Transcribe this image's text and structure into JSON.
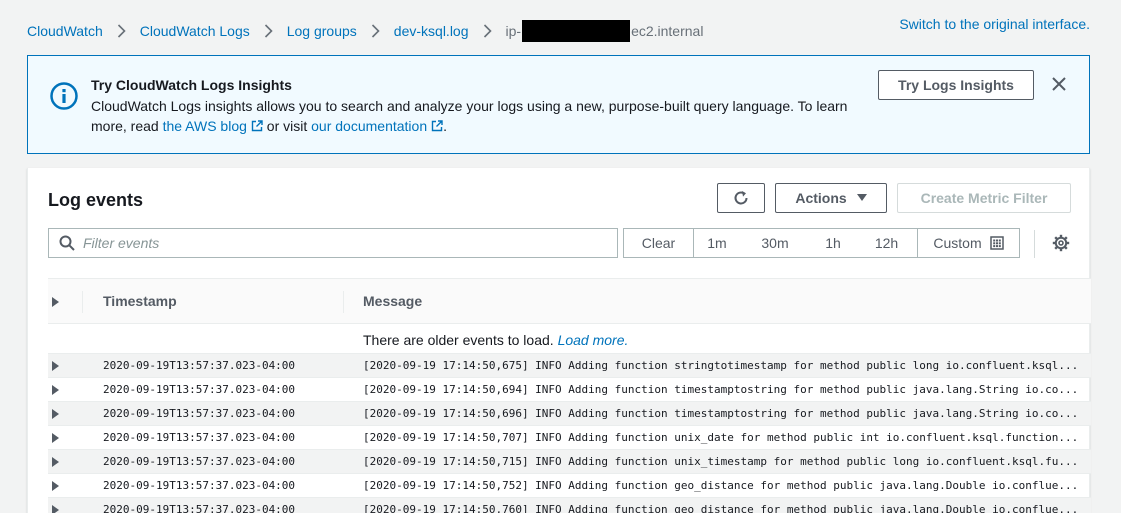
{
  "breadcrumb": {
    "items": [
      "CloudWatch",
      "CloudWatch Logs",
      "Log groups",
      "dev-ksql.log"
    ],
    "current_prefix": "ip-",
    "current_suffix": "ec2.internal"
  },
  "switch_link": "Switch to the original interface.",
  "banner": {
    "title": "Try CloudWatch Logs Insights",
    "text_before": "CloudWatch Logs insights allows you to search and analyze your logs using a new, purpose-built query language. To learn more, read ",
    "link_blog": "the AWS blog",
    "text_middle": " or visit ",
    "link_docs": "our documentation",
    "text_after": ".",
    "button": "Try Logs Insights"
  },
  "panel": {
    "title": "Log events",
    "actions_label": "Actions",
    "metric_label": "Create Metric Filter",
    "filter_placeholder": "Filter events",
    "ranges": {
      "clear": "Clear",
      "m1": "1m",
      "m30": "30m",
      "h1": "1h",
      "h12": "12h",
      "custom": "Custom"
    },
    "columns": {
      "timestamp": "Timestamp",
      "message": "Message"
    },
    "older_text": "There are older events to load. ",
    "load_more": "Load more.",
    "rows": [
      {
        "ts": "2020-09-19T13:57:37.023-04:00",
        "msg": "[2020-09-19 17:14:50,675] INFO Adding function stringtotimestamp for method public long io.confluent.ksql..."
      },
      {
        "ts": "2020-09-19T13:57:37.023-04:00",
        "msg": "[2020-09-19 17:14:50,694] INFO Adding function timestamptostring for method public java.lang.String io.co..."
      },
      {
        "ts": "2020-09-19T13:57:37.023-04:00",
        "msg": "[2020-09-19 17:14:50,696] INFO Adding function timestamptostring for method public java.lang.String io.co..."
      },
      {
        "ts": "2020-09-19T13:57:37.023-04:00",
        "msg": "[2020-09-19 17:14:50,707] INFO Adding function unix_date for method public int io.confluent.ksql.function..."
      },
      {
        "ts": "2020-09-19T13:57:37.023-04:00",
        "msg": "[2020-09-19 17:14:50,715] INFO Adding function unix_timestamp for method public long io.confluent.ksql.fu..."
      },
      {
        "ts": "2020-09-19T13:57:37.023-04:00",
        "msg": "[2020-09-19 17:14:50,752] INFO Adding function geo_distance for method public java.lang.Double io.conflue..."
      },
      {
        "ts": "2020-09-19T13:57:37.023-04:00",
        "msg": "[2020-09-19 17:14:50,760] INFO Adding function geo_distance for method public java.lang.Double io.conflue..."
      }
    ]
  },
  "colors": {
    "link": "#0073bb",
    "banner_bg": "#f1faff",
    "banner_border": "#0073bb",
    "page_bg": "#f2f3f3"
  },
  "icons": [
    "chevron-right-icon",
    "info-icon",
    "external-link-icon",
    "close-icon",
    "refresh-icon",
    "caret-down-icon",
    "search-icon",
    "calendar-icon",
    "gear-icon",
    "expand-caret-icon"
  ]
}
